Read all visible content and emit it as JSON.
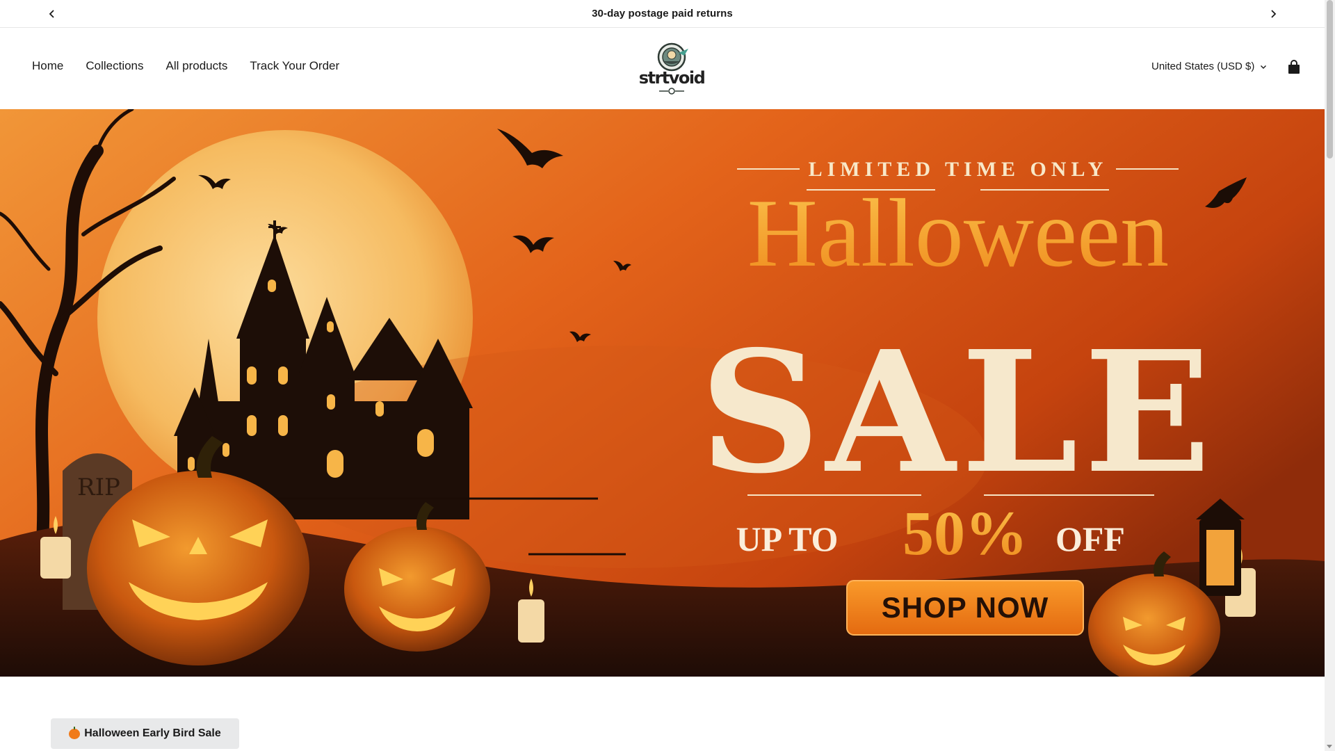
{
  "announcement": {
    "text": "30-day postage paid returns",
    "prev_icon": "chevron-left-icon",
    "next_icon": "chevron-right-icon"
  },
  "header": {
    "nav": [
      {
        "label": "Home"
      },
      {
        "label": "Collections"
      },
      {
        "label": "All products"
      },
      {
        "label": "Track Your Order"
      }
    ],
    "logo_text": "strtvoid",
    "currency": "United States (USD $)",
    "currency_icon": "chevron-down-icon",
    "cart_icon": "shopping-bag-icon"
  },
  "hero": {
    "kicker": "LIMITED TIME ONLY",
    "headline": "Halloween",
    "sale": "SALE",
    "offer_prefix": "UP TO",
    "offer_value": "50%",
    "offer_suffix": "OFF",
    "cta": "SHOP NOW",
    "tombstone_text": "RIP",
    "colors": {
      "sky": "#e8641a",
      "moon": "#f7c770",
      "accent": "#f59a1e",
      "cream": "#f6ead2",
      "cta": "#f07a12"
    }
  },
  "section": {
    "badge_text": "Halloween Early Bird Sale",
    "badge_icon": "pumpkin-icon"
  }
}
